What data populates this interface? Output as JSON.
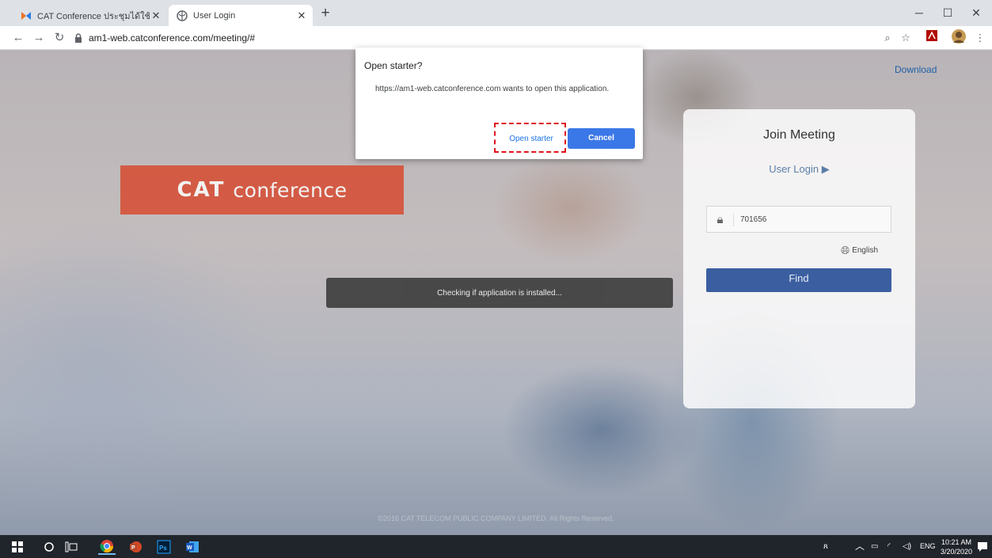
{
  "browser": {
    "tabs": [
      {
        "title": "CAT Conference ประชุมได้ใช้ชื่อจากฯ",
        "active": false
      },
      {
        "title": "User Login",
        "active": true
      }
    ],
    "url": "am1-web.catconference.com/meeting/#"
  },
  "page": {
    "download_link": "Download",
    "logo_bold": "CAT",
    "logo_light": "conference",
    "status_toast": "Checking if application is installed...",
    "join_card": {
      "title": "Join Meeting",
      "user_login": "User Login ▶",
      "meeting_id_value": "701656",
      "language": "English",
      "find_button": "Find"
    },
    "footer": "©2016 CAT TELECOM PUBLIC COMPANY LIMITED. All Rights Reserved."
  },
  "dialog": {
    "title": "Open starter?",
    "message": "https://am1-web.catconference.com wants to open this application.",
    "open_button": "Open starter",
    "cancel_button": "Cancel"
  },
  "taskbar": {
    "language": "ENG",
    "time": "10:21 AM",
    "date": "3/20/2020"
  },
  "colors": {
    "accent_blue": "#3b78e7",
    "logo_red": "#d8472b",
    "find_blue": "#3b5ea0",
    "highlight_red": "#e0141e"
  }
}
